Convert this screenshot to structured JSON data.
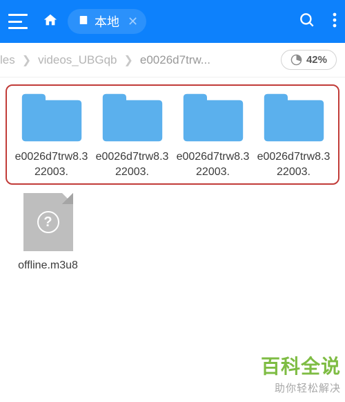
{
  "header": {
    "tab_label": "本地"
  },
  "breadcrumb": {
    "items": [
      "les",
      "videos_UBGqb",
      "e0026d7trw..."
    ]
  },
  "storage": {
    "percent_label": "42%",
    "percent_value": 42
  },
  "folders": [
    {
      "name": "e0026d7trw8.322003."
    },
    {
      "name": "e0026d7trw8.322003."
    },
    {
      "name": "e0026d7trw8.322003."
    },
    {
      "name": "e0026d7trw8.322003."
    }
  ],
  "files": [
    {
      "name": "offline.m3u8"
    }
  ],
  "watermark": {
    "title": "百科全说",
    "subtitle": "助你轻松解决"
  },
  "colors": {
    "header": "#0d81fc",
    "folder": "#5bb0ed",
    "highlight": "#c13b38"
  }
}
